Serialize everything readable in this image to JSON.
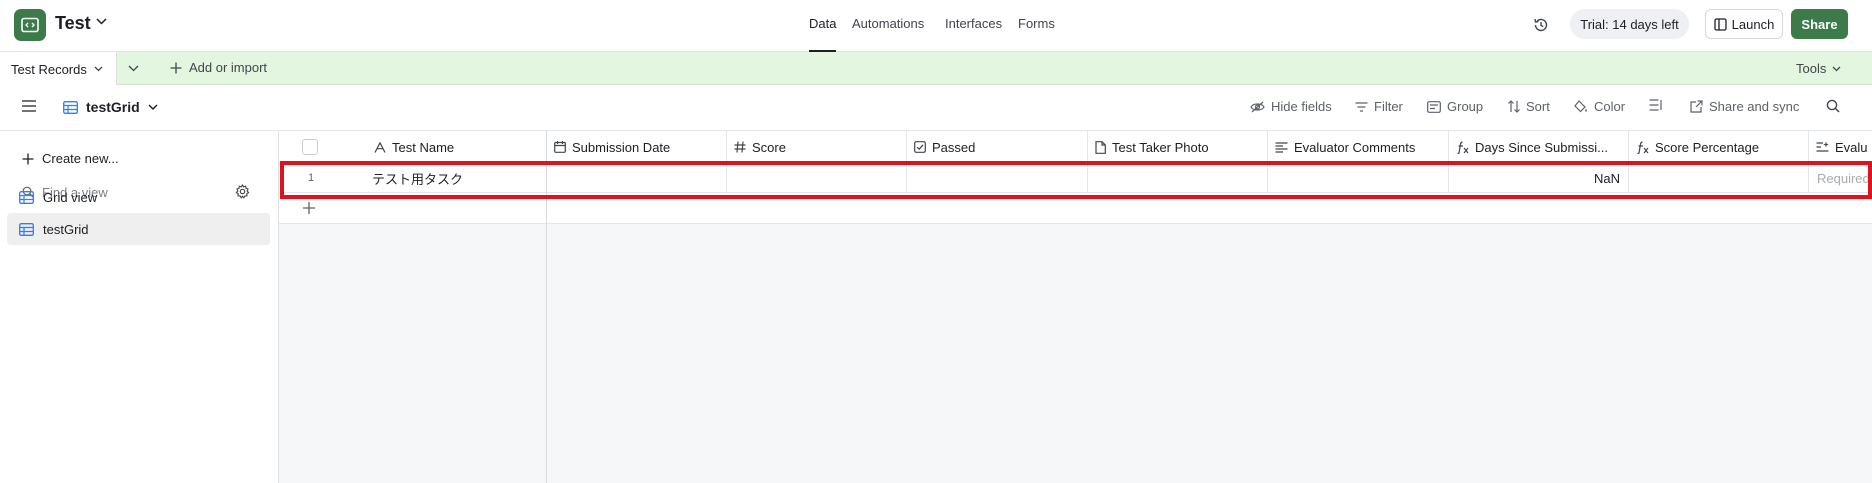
{
  "app": {
    "name": "Test",
    "brand_color": "#3d7a4a",
    "nav": [
      "Data",
      "Automations",
      "Interfaces",
      "Forms"
    ],
    "active_nav": "Data",
    "trial_badge": "Trial: 14 days left",
    "launch_label": "Launch",
    "share_label": "Share"
  },
  "tablebar": {
    "active_table": "Test Records",
    "add_import_label": "Add or import",
    "tools_label": "Tools",
    "tab_bg_color": "#e3f6df"
  },
  "viewbar": {
    "current_view": "testGrid",
    "tools": [
      "Hide fields",
      "Filter",
      "Group",
      "Sort",
      "Color",
      "",
      "Share and sync"
    ]
  },
  "sidebar": {
    "create_new_label": "Create new...",
    "find_placeholder": "Find a view",
    "views": [
      {
        "label": "Grid view",
        "icon": "grid-view-icon",
        "selected": false
      },
      {
        "label": "testGrid",
        "icon": "grid-view-icon",
        "selected": true
      }
    ]
  },
  "grid": {
    "columns": [
      {
        "label": "Test Name",
        "icon": "text-field-icon"
      },
      {
        "label": "Submission Date",
        "icon": "calendar-icon"
      },
      {
        "label": "Score",
        "icon": "number-icon"
      },
      {
        "label": "Passed",
        "icon": "checkbox-icon"
      },
      {
        "label": "Test Taker Photo",
        "icon": "attachment-icon"
      },
      {
        "label": "Evaluator Comments",
        "icon": "long-text-icon"
      },
      {
        "label": "Days Since Submissi...",
        "icon": "formula-icon"
      },
      {
        "label": "Score Percentage",
        "icon": "formula-icon"
      },
      {
        "label": "Evalu",
        "icon": "ai-text-icon"
      }
    ],
    "rows": [
      {
        "number": "1",
        "cells": [
          "テスト用タスク",
          "",
          "",
          "",
          "",
          "",
          "NaN",
          "",
          "Required"
        ]
      }
    ],
    "highlight_color": "#e0121b"
  }
}
